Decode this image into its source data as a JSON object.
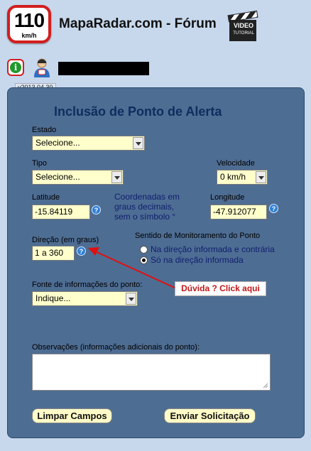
{
  "header": {
    "logo_number": "110",
    "logo_unit": "km/h",
    "site_title": "MapaRadar.com - Fórum",
    "video_line1": "VIDEO",
    "video_line2": "TUTORIAL",
    "version": "v2013.04.30"
  },
  "form": {
    "title": "Inclusão de Ponto de Alerta",
    "estado": {
      "label": "Estado",
      "value": "Selecione..."
    },
    "tipo": {
      "label": "Tipo",
      "value": "Selecione..."
    },
    "velocidade": {
      "label": "Velocidade",
      "value": "0 km/h"
    },
    "latitude": {
      "label": "Latitude",
      "value": "-15.84119"
    },
    "coord_note": [
      "Coordenadas em",
      "graus decimais,",
      "sem o símbolo °"
    ],
    "longitude": {
      "label": "Longitude",
      "value": "-47.912077"
    },
    "direcao": {
      "label": "Direção (em graus)",
      "value": "1 a 360"
    },
    "sentido": {
      "label": "Sentido de Monitoramento do Ponto",
      "options": [
        "Na direção informada e contrária",
        "Só na direção informada"
      ],
      "selected_index": 1
    },
    "fonte": {
      "label": "Fonte de informações do ponto:",
      "value": "Indique..."
    },
    "tooltip": "Dúvida ? Click aqui",
    "observacoes": {
      "label": "Observações (informações adicionais do ponto):",
      "value": ""
    },
    "buttons": {
      "clear": "Limpar Campos",
      "submit": "Enviar Solicitação"
    },
    "help_glyph": "?"
  },
  "colors": {
    "panel": "#4e6d93",
    "field_bg": "#ffffcc",
    "title": "#0e2d5e",
    "arrow": "#e01010"
  }
}
